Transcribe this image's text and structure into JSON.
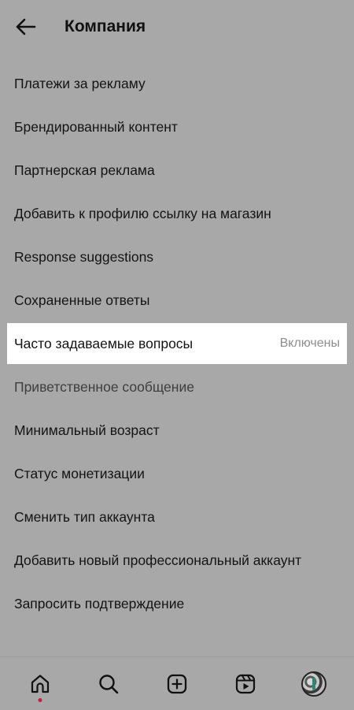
{
  "header": {
    "title": "Компания"
  },
  "menu": {
    "items": [
      {
        "label": "Платежи за рекламу"
      },
      {
        "label": "Брендированный контент"
      },
      {
        "label": "Партнерская реклама"
      },
      {
        "label": "Добавить к профилю ссылку на магазин"
      },
      {
        "label": "Response suggestions"
      },
      {
        "label": "Сохраненные ответы"
      },
      {
        "label": "Часто задаваемые вопросы",
        "value": "Включены"
      },
      {
        "label": "Приветственное сообщение"
      },
      {
        "label": "Минимальный возраст"
      },
      {
        "label": "Статус монетизации"
      },
      {
        "label": "Сменить тип аккаунта"
      },
      {
        "label": "Добавить новый профессиональный аккаунт"
      },
      {
        "label": "Запросить подтверждение"
      }
    ]
  },
  "bottom_nav": {
    "items": [
      {
        "icon": "home-icon",
        "active": true
      },
      {
        "icon": "search-icon"
      },
      {
        "icon": "new-post-icon"
      },
      {
        "icon": "reels-icon"
      },
      {
        "icon": "profile-avatar"
      }
    ]
  },
  "colors": {
    "overlay_background": "#a8a8a8",
    "highlight_background": "#ffffff",
    "notification_dot": "#c81e3c",
    "value_text": "#8e8e8e"
  }
}
